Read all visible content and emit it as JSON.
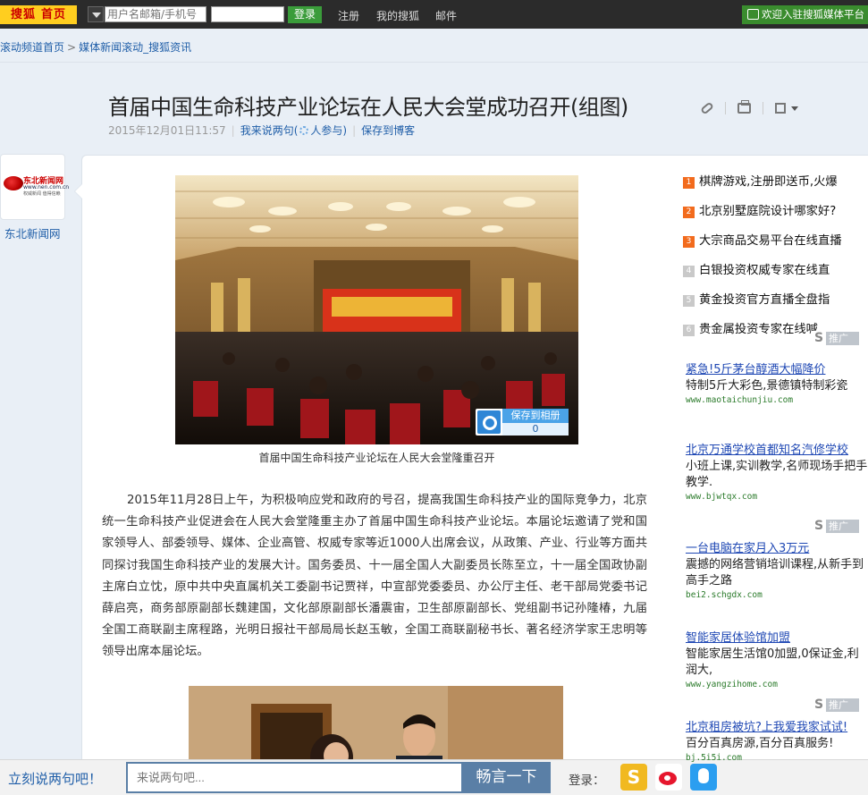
{
  "topbar": {
    "logo_brand": "搜狐",
    "logo_home": "首页",
    "user_placeholder": "用户名邮箱/手机号",
    "login_label": "登录",
    "links": [
      "注册",
      "我的搜狐",
      "邮件"
    ],
    "welcome": "欢迎入驻搜狐媒体平台"
  },
  "breadcrumb": {
    "items": [
      "滚动频道首页",
      "媒体新闻滚动_搜狐资讯"
    ],
    "separator": ">"
  },
  "article": {
    "title": "首届中国生命科技产业论坛在人民大会堂成功召开(组图)",
    "date": "2015年12月01日11:57",
    "comment_link": "我来说两句(",
    "participants_label": "人参与)",
    "save_blog": "保存到博客",
    "photo_caption": "首届中国生命科技产业论坛在人民大会堂隆重召开",
    "save_photo_label": "保存到相册",
    "save_photo_count": "0",
    "body": "2015年11月28日上午，为积极响应党和政府的号召，提高我国生命科技产业的国际竞争力，北京统一生命科技产业促进会在人民大会堂隆重主办了首届中国生命科技产业论坛。本届论坛邀请了党和国家领导人、部委领导、媒体、企业高管、权威专家等近1000人出席会议，从政策、产业、行业等方面共同探讨我国生命科技产业的发展大计。国务委员、十一届全国人大副委员长陈至立，十一届全国政协副主席白立忱，原中共中央直属机关工委副书记贾祥，中宣部党委委员、办公厅主任、老干部局党委书记薛启亮，商务部原副部长魏建国，文化部原副部长潘震宙，卫生部原副部长、党组副书记孙隆椿，九届全国工商联副主席程路，光明日报社干部局局长赵玉敏，全国工商联副秘书长、著名经济学家王忠明等领导出席本届论坛。"
  },
  "source": {
    "logo_title": "东北新闻网",
    "logo_url": "www.nen.com.cn",
    "logo_slogan": "权威新闻  值得信赖",
    "name": "东北新闻网"
  },
  "hot_list": [
    {
      "num": "1",
      "text": "棋牌游戏,注册即送币,火爆",
      "color": "#f26b1d"
    },
    {
      "num": "2",
      "text": "北京别墅庭院设计哪家好?",
      "color": "#f26b1d"
    },
    {
      "num": "3",
      "text": "大宗商品交易平台在线直播",
      "color": "#f26b1d"
    },
    {
      "num": "4",
      "text": "白银投资权威专家在线直",
      "color": "#c9c9c9"
    },
    {
      "num": "5",
      "text": "黄金投资官方直播全盘指",
      "color": "#c9c9c9"
    },
    {
      "num": "6",
      "text": "贵金属投资专家在线喊",
      "color": "#c9c9c9"
    }
  ],
  "promo_label": "推广",
  "promo_s": "S",
  "ads": [
    {
      "title": "紧急!5斤茅台醇酒大幅降价",
      "desc": "特制5斤大彩色,景德镇特制彩瓷",
      "url": "www.maotaichunjiu.com"
    },
    {
      "title": "北京万通学校首都知名汽修学校",
      "desc": "小班上课,实训教学,名师现场手把手教学.",
      "url": "www.bjwtqx.com"
    },
    {
      "title": "一台电脑在家月入3万元",
      "desc": "震撼的网络营销培训课程,从新手到高手之路",
      "url": "bei2.schgdx.com"
    },
    {
      "title": "智能家居体验馆加盟",
      "desc": "智能家居生活馆0加盟,0保证金,利润大,",
      "url": "www.yangzihome.com"
    },
    {
      "title": "北京租房被坑?上我爱我家试试!",
      "desc": "百分百真房源,百分百真服务!",
      "url": "bj.5i5i.com"
    }
  ],
  "bottom": {
    "say_label": "立刻说两句吧！",
    "input_placeholder": "来说两句吧...",
    "submit_label": "畅言一下",
    "login_label": "登录："
  }
}
